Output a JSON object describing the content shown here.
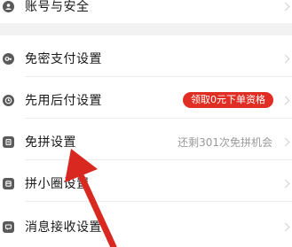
{
  "account_security": {
    "label": "账号与安全",
    "icon": "person-shield-icon"
  },
  "settings": {
    "items": [
      {
        "label": "免密支付设置",
        "icon": "key-icon",
        "value": "",
        "badge": ""
      },
      {
        "label": "先用后付设置",
        "icon": "clock-icon",
        "value": "",
        "badge": "领取0元下单资格"
      },
      {
        "label": "免拼设置",
        "icon": "document-icon",
        "value": "还剩301次免拼机会",
        "badge": ""
      },
      {
        "label": "拼小圈设置",
        "icon": "circle-group-icon",
        "value": "",
        "badge": ""
      },
      {
        "label": "消息接收设置",
        "icon": "message-icon",
        "value": "",
        "badge": ""
      }
    ]
  },
  "colors": {
    "accent": "#e02e24",
    "annotation_arrow": "#d8281f"
  }
}
